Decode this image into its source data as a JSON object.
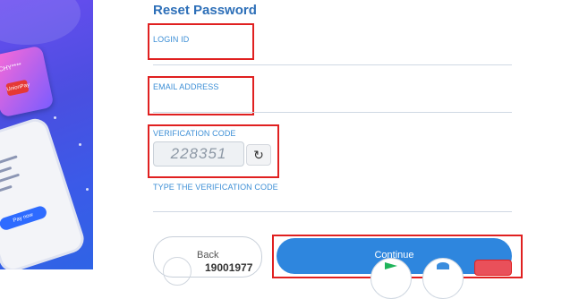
{
  "sidebar": {
    "card_label": "CHY****",
    "card_brand": "UnionPay",
    "phone_button": "Pay now"
  },
  "form": {
    "title": "Reset Password",
    "login_id_label": "LOGIN ID",
    "email_label": "EMAIL ADDRESS",
    "verification_label": "VERIFICATION CODE",
    "captcha_value": "228351",
    "refresh_icon": "refresh-icon",
    "type_code_label": "TYPE THE VERIFICATION CODE"
  },
  "actions": {
    "back_label": "Back",
    "hotline": "19001977",
    "continue_label": "Continue"
  },
  "colors": {
    "accent": "#2e86de",
    "label": "#3d8fd6",
    "title": "#2d6fb8",
    "highlight": "#e02020"
  }
}
